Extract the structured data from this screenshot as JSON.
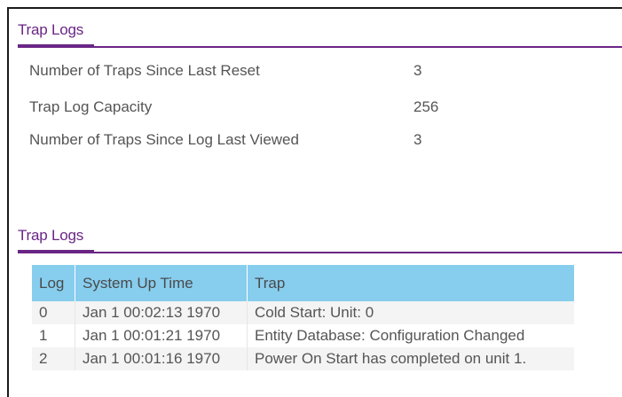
{
  "summary_section": {
    "title": "Trap Logs",
    "rows": [
      {
        "label": "Number of Traps Since Last Reset",
        "value": "3"
      },
      {
        "label": "Trap Log Capacity",
        "value": "256"
      },
      {
        "label": "Number of Traps Since Log Last Viewed",
        "value": "3"
      }
    ]
  },
  "log_section": {
    "title": "Trap Logs",
    "columns": [
      "Log",
      "System Up Time",
      "Trap"
    ],
    "rows": [
      {
        "log": "0",
        "time": "Jan 1 00:02:13 1970",
        "trap": "Cold Start: Unit: 0"
      },
      {
        "log": "1",
        "time": "Jan 1 00:01:21 1970",
        "trap": "Entity Database: Configuration Changed"
      },
      {
        "log": "2",
        "time": "Jan 1 00:01:16 1970",
        "trap": "Power On Start has completed on unit 1."
      }
    ]
  },
  "colors": {
    "accent": "#6a2585",
    "table_header": "#87cdee",
    "text": "#555555"
  }
}
